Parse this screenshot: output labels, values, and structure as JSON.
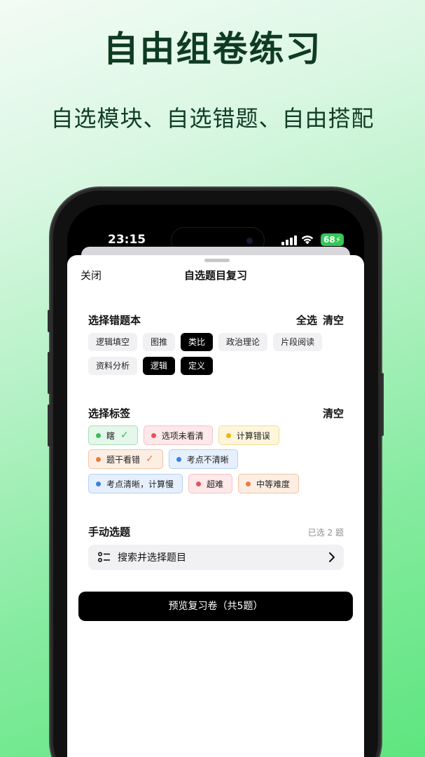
{
  "promo": {
    "title": "自由组卷练习",
    "subtitle": "自选模块、自选错题、自由搭配"
  },
  "status_bar": {
    "time": "23:15",
    "battery": "68"
  },
  "sheet": {
    "close_label": "关闭",
    "title": "自选题目复习"
  },
  "notebooks": {
    "title": "选择错题本",
    "select_all": "全选",
    "clear": "清空",
    "items": [
      {
        "label": "逻辑填空",
        "selected": false
      },
      {
        "label": "图推",
        "selected": false
      },
      {
        "label": "类比",
        "selected": true
      },
      {
        "label": "政治理论",
        "selected": false
      },
      {
        "label": "片段阅读",
        "selected": false
      },
      {
        "label": "资料分析",
        "selected": false
      },
      {
        "label": "逻辑",
        "selected": true
      },
      {
        "label": "定义",
        "selected": true
      }
    ]
  },
  "tags": {
    "title": "选择标签",
    "clear": "清空",
    "items": [
      {
        "label": "瞎",
        "color": "#34c15a",
        "checked": true
      },
      {
        "label": "选项未看清",
        "color": "#e8505b",
        "checked": false
      },
      {
        "label": "计算错误",
        "color": "#f1b70c",
        "checked": false
      },
      {
        "label": "题干看错",
        "color": "#ef7a3a",
        "checked": true
      },
      {
        "label": "考点不清晰",
        "color": "#3c7ee8",
        "checked": false
      },
      {
        "label": "考点清晰，计算慢",
        "color": "#3c7ee8",
        "checked": false
      },
      {
        "label": "超难",
        "color": "#e8505b",
        "checked": false
      },
      {
        "label": "中等难度",
        "color": "#ef7a3a",
        "checked": false
      }
    ],
    "check_mark": "✓"
  },
  "manual": {
    "title": "手动选题",
    "selected_count": "已选 2 题",
    "search_label": "搜索并选择题目"
  },
  "preview_button": "预览复习卷（共5题）",
  "icons": {
    "list": "list-icon",
    "chevron": "chevron-right-icon",
    "wifi": "wifi-icon",
    "signal": "signal-icon"
  }
}
